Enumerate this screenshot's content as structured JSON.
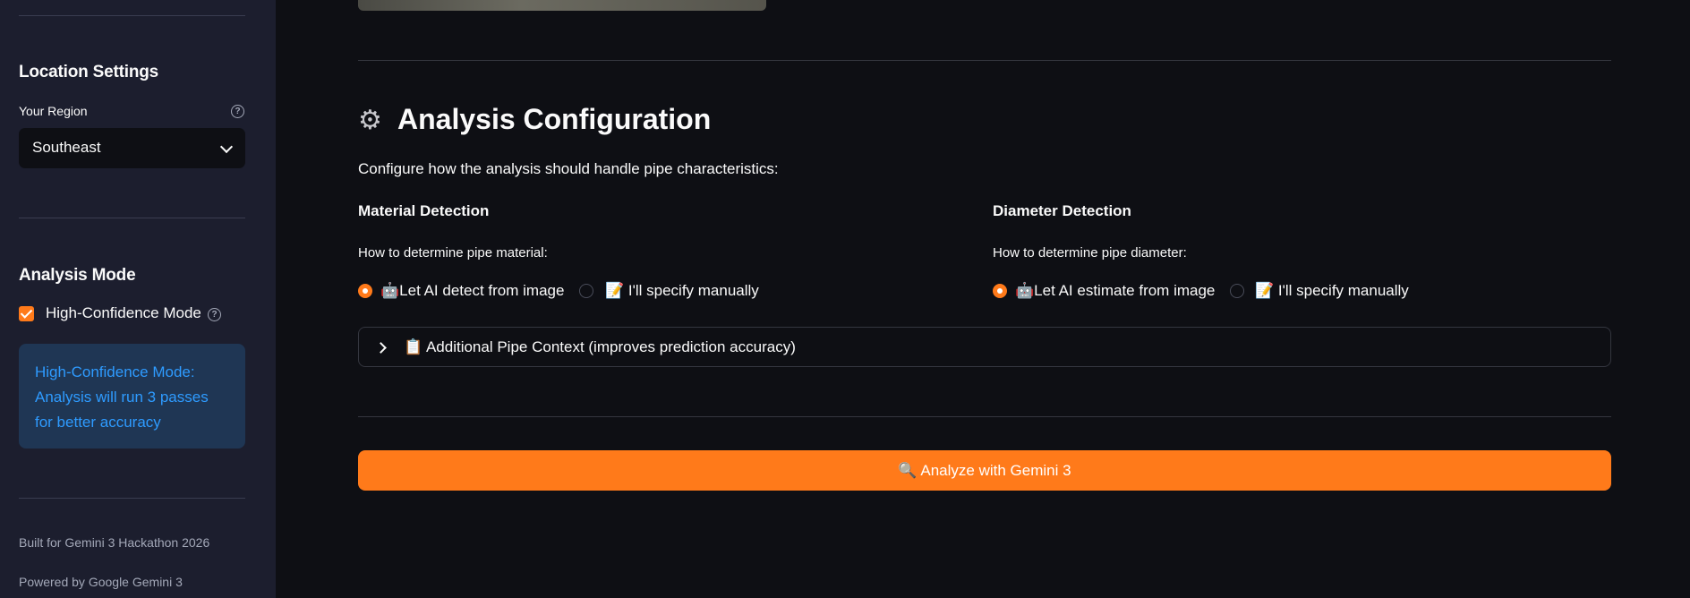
{
  "sidebar": {
    "location_heading": "Location Settings",
    "region_label": "Your Region",
    "region_value": "Southeast",
    "analysis_heading": "Analysis Mode",
    "high_conf_label": "High-Confidence Mode",
    "high_conf_checked": true,
    "info_text": "High-Confidence Mode: Analysis will run 3 passes for better accuracy",
    "footer_1": "Built for Gemini 3 Hackathon 2026",
    "footer_2": "Powered by Google Gemini 3"
  },
  "main": {
    "title": "Analysis Configuration",
    "title_icon": "gear-icon",
    "intro": "Configure how the analysis should handle pipe characteristics:",
    "material": {
      "heading": "Material Detection",
      "question": "How to determine pipe material:",
      "option_ai": "🤖Let AI detect from image",
      "option_manual": "📝 I'll specify manually",
      "selected": "ai"
    },
    "diameter": {
      "heading": "Diameter Detection",
      "question": "How to determine pipe diameter:",
      "option_ai": "🤖Let AI estimate from image",
      "option_manual": "📝 I'll specify manually",
      "selected": "ai"
    },
    "expander_label": "📋 Additional Pipe Context (improves prediction accuracy)",
    "analyze_button": "🔍 Analyze with Gemini 3"
  },
  "colors": {
    "accent": "#ff7a1a",
    "background": "#0e0f14",
    "sidebar": "#1c1e2e",
    "info_bg": "#1f3654",
    "info_text": "#2e9bff"
  }
}
